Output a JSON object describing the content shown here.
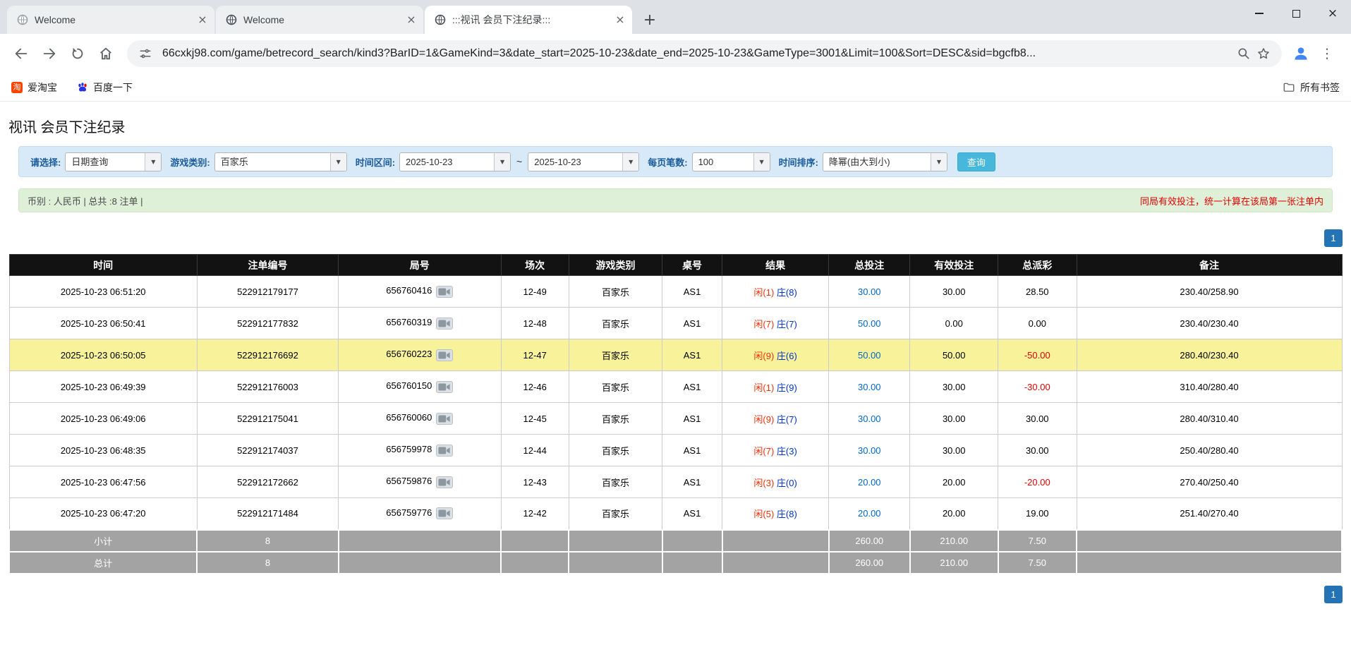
{
  "browser": {
    "tabs": [
      {
        "title": "Welcome"
      },
      {
        "title": "Welcome"
      },
      {
        "title": ":::视讯 会员下注纪录:::"
      }
    ],
    "url": "66cxkj98.com/game/betrecord_search/kind3?BarID=1&GameKind=3&date_start=2025-10-23&date_end=2025-10-23&GameType=3001&Limit=100&Sort=DESC&sid=bgcfb8...",
    "bookmarks": [
      {
        "label": "爱淘宝"
      },
      {
        "label": "百度一下"
      }
    ],
    "all_bookmarks_label": "所有书签"
  },
  "icons": {
    "tab_close": "×",
    "new_tab": "+",
    "window_close": "×",
    "menu_dots": "⋮",
    "dropdown_arrow": "▼",
    "taobao_glyph": "淘"
  },
  "page": {
    "title": "视讯 会员下注纪录",
    "filters": {
      "select_label": "请选择:",
      "select_value": "日期查询",
      "game_type_label": "游戏类别:",
      "game_type_value": "百家乐",
      "date_range_label": "时间区间:",
      "date_start": "2025-10-23",
      "date_separator": "~",
      "date_end": "2025-10-23",
      "page_size_label": "每页笔数:",
      "page_size_value": "100",
      "sort_label": "时间排序:",
      "sort_value": "降幂(由大到小)",
      "search_button": "查询"
    },
    "summary_bar": {
      "left": "币别 : 人民币 | 总共 :8 注单 |",
      "right": "同局有效投注，统一计算在该局第一张注单内"
    },
    "pagination": {
      "current": "1"
    },
    "table": {
      "headers": [
        "时间",
        "注单编号",
        "局号",
        "场次",
        "游戏类别",
        "桌号",
        "结果",
        "总投注",
        "有效投注",
        "总派彩",
        "备注"
      ],
      "rows": [
        {
          "time": "2025-10-23 06:51:20",
          "bet_id": "522912179177",
          "round": "656760416",
          "session": "12-49",
          "game": "百家乐",
          "table": "AS1",
          "result_player": "闲(1)",
          "result_banker": "庄(8)",
          "total_bet": "30.00",
          "valid_bet": "30.00",
          "payout": "28.50",
          "remark": "230.40/258.90",
          "highlighted": false
        },
        {
          "time": "2025-10-23 06:50:41",
          "bet_id": "522912177832",
          "round": "656760319",
          "session": "12-48",
          "game": "百家乐",
          "table": "AS1",
          "result_player": "闲(7)",
          "result_banker": "庄(7)",
          "total_bet": "50.00",
          "valid_bet": "0.00",
          "payout": "0.00",
          "remark": "230.40/230.40",
          "highlighted": false
        },
        {
          "time": "2025-10-23 06:50:05",
          "bet_id": "522912176692",
          "round": "656760223",
          "session": "12-47",
          "game": "百家乐",
          "table": "AS1",
          "result_player": "闲(9)",
          "result_banker": "庄(6)",
          "total_bet": "50.00",
          "valid_bet": "50.00",
          "payout": "-50.00",
          "remark": "280.40/230.40",
          "highlighted": true
        },
        {
          "time": "2025-10-23 06:49:39",
          "bet_id": "522912176003",
          "round": "656760150",
          "session": "12-46",
          "game": "百家乐",
          "table": "AS1",
          "result_player": "闲(1)",
          "result_banker": "庄(9)",
          "total_bet": "30.00",
          "valid_bet": "30.00",
          "payout": "-30.00",
          "remark": "310.40/280.40",
          "highlighted": false
        },
        {
          "time": "2025-10-23 06:49:06",
          "bet_id": "522912175041",
          "round": "656760060",
          "session": "12-45",
          "game": "百家乐",
          "table": "AS1",
          "result_player": "闲(9)",
          "result_banker": "庄(7)",
          "total_bet": "30.00",
          "valid_bet": "30.00",
          "payout": "30.00",
          "remark": "280.40/310.40",
          "highlighted": false
        },
        {
          "time": "2025-10-23 06:48:35",
          "bet_id": "522912174037",
          "round": "656759978",
          "session": "12-44",
          "game": "百家乐",
          "table": "AS1",
          "result_player": "闲(7)",
          "result_banker": "庄(3)",
          "total_bet": "30.00",
          "valid_bet": "30.00",
          "payout": "30.00",
          "remark": "250.40/280.40",
          "highlighted": false
        },
        {
          "time": "2025-10-23 06:47:56",
          "bet_id": "522912172662",
          "round": "656759876",
          "session": "12-43",
          "game": "百家乐",
          "table": "AS1",
          "result_player": "闲(3)",
          "result_banker": "庄(0)",
          "total_bet": "20.00",
          "valid_bet": "20.00",
          "payout": "-20.00",
          "remark": "270.40/250.40",
          "highlighted": false
        },
        {
          "time": "2025-10-23 06:47:20",
          "bet_id": "522912171484",
          "round": "656759776",
          "session": "12-42",
          "game": "百家乐",
          "table": "AS1",
          "result_player": "闲(5)",
          "result_banker": "庄(8)",
          "total_bet": "20.00",
          "valid_bet": "20.00",
          "payout": "19.00",
          "remark": "251.40/270.40",
          "highlighted": false
        }
      ],
      "subtotal": {
        "label": "小计",
        "count": "8",
        "total_bet": "260.00",
        "valid_bet": "210.00",
        "payout": "7.50"
      },
      "total": {
        "label": "总计",
        "count": "8",
        "total_bet": "260.00",
        "valid_bet": "210.00",
        "payout": "7.50"
      }
    }
  },
  "colors": {
    "accent_blue": "#2473b5",
    "link_blue": "#0066cc",
    "negative_red": "#e60000",
    "player_red": "#e8330a",
    "banker_blue": "#0033cc",
    "highlight_yellow": "#f8f29b",
    "header_bg": "#121212",
    "summary_bg": "#a3a3a3",
    "filter_bg": "#d8eaf7",
    "info_bg": "#dff0d8",
    "search_button_bg": "#47b8dc",
    "label_blue": "#1a5b9c"
  }
}
